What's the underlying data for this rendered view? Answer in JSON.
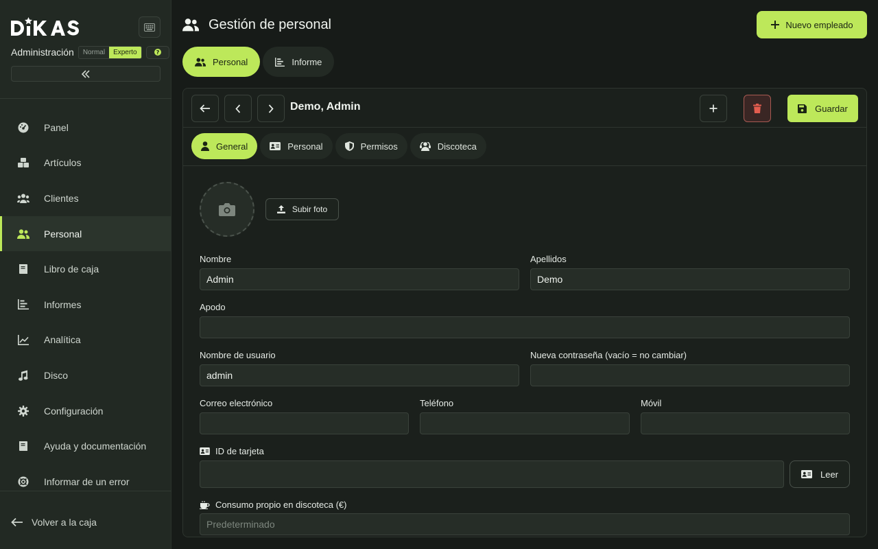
{
  "sidebar": {
    "logo_text": "DIKAS",
    "admin_label": "Administración",
    "modes": [
      "Normal",
      "Experto"
    ],
    "active_mode": "Experto",
    "nav": [
      {
        "label": "Panel",
        "icon": "gauge-icon"
      },
      {
        "label": "Artículos",
        "icon": "boxes-icon"
      },
      {
        "label": "Clientes",
        "icon": "users-group-icon"
      },
      {
        "label": "Personal",
        "icon": "user-friends-icon",
        "active": true
      },
      {
        "label": "Libro de caja",
        "icon": "book-icon"
      },
      {
        "label": "Informes",
        "icon": "bar-chart-icon"
      },
      {
        "label": "Analítica",
        "icon": "line-chart-icon"
      },
      {
        "label": "Disco",
        "icon": "music-icon"
      },
      {
        "label": "Configuración",
        "icon": "gear-icon"
      },
      {
        "label": "Ayuda y documentación",
        "icon": "book-icon"
      },
      {
        "label": "Informar de un error",
        "icon": "lifebuoy-icon"
      }
    ],
    "back_label": "Volver a la caja"
  },
  "header": {
    "title": "Gestión de personal",
    "new_button": "Nuevo empleado"
  },
  "top_tabs": [
    {
      "label": "Personal",
      "active": true
    },
    {
      "label": "Informe",
      "active": false
    }
  ],
  "record": {
    "name": "Demo, Admin",
    "save_label": "Guardar"
  },
  "sub_tabs": [
    {
      "label": "General",
      "active": true
    },
    {
      "label": "Personal",
      "active": false
    },
    {
      "label": "Permisos",
      "active": false
    },
    {
      "label": "Discoteca",
      "active": false
    }
  ],
  "form": {
    "upload_label": "Subir foto",
    "nombre": {
      "label": "Nombre",
      "value": "Admin"
    },
    "apellidos": {
      "label": "Apellidos",
      "value": "Demo"
    },
    "apodo": {
      "label": "Apodo",
      "value": ""
    },
    "usuario": {
      "label": "Nombre de usuario",
      "value": "admin"
    },
    "password": {
      "label": "Nueva contraseña (vacío = no cambiar)",
      "value": ""
    },
    "email": {
      "label": "Correo electrónico",
      "value": ""
    },
    "telefono": {
      "label": "Teléfono",
      "value": ""
    },
    "movil": {
      "label": "Móvil",
      "value": ""
    },
    "tarjeta": {
      "label": "ID de tarjeta",
      "value": "",
      "read_label": "Leer"
    },
    "consumo": {
      "label": "Consumo propio en discoteca (€)",
      "value": "",
      "placeholder": "Predeterminado"
    }
  },
  "colors": {
    "accent": "#bde85a",
    "danger": "#e35d4f",
    "background": "#171b18",
    "sidebar": "#222923"
  }
}
